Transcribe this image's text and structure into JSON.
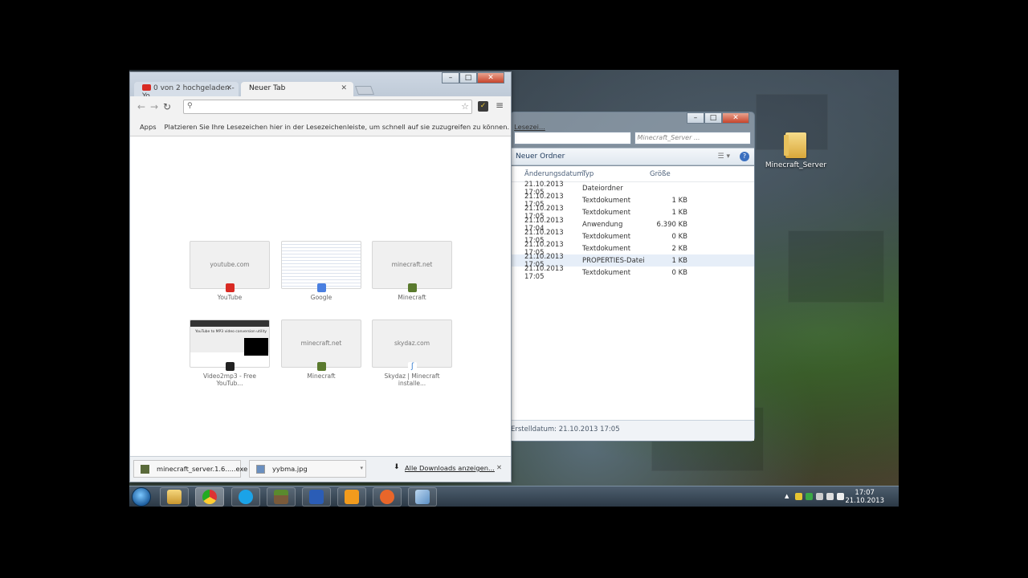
{
  "colors": {
    "chrome_tab_bg": "#f2f2f2",
    "accent": "#1e395b",
    "youtube_red": "#d82a23"
  },
  "desktop": {
    "icon_label": "Minecraft_Server",
    "icon": "folder-icon"
  },
  "explorer": {
    "search_placeholder": "Minecraft_Server ...",
    "cmd_item": "Neuer Ordner",
    "columns": [
      "Änderungsdatum",
      "Typ",
      "Größe"
    ],
    "rows": [
      {
        "date": "21.10.2013 17:05",
        "type": "Dateiordner",
        "size": ""
      },
      {
        "date": "21.10.2013 17:05",
        "type": "Textdokument",
        "size": "1 KB"
      },
      {
        "date": "21.10.2013 17:05",
        "type": "Textdokument",
        "size": "1 KB"
      },
      {
        "date": "21.10.2013 17:04",
        "type": "Anwendung",
        "size": "6.390 KB"
      },
      {
        "date": "21.10.2013 17:05",
        "type": "Textdokument",
        "size": "0 KB"
      },
      {
        "date": "21.10.2013 17:05",
        "type": "Textdokument",
        "size": "2 KB"
      },
      {
        "date": "21.10.2013 17:05",
        "type": "PROPERTIES-Datei",
        "size": "1 KB"
      },
      {
        "date": "21.10.2013 17:05",
        "type": "Textdokument",
        "size": "0 KB"
      }
    ],
    "status": "Erstelldatum: 21.10.2013 17:05"
  },
  "chrome": {
    "tabs": [
      {
        "label": "0 von 2 hochgeladen - Yo"
      },
      {
        "label": "Neuer Tab"
      }
    ],
    "omnibox_value": "",
    "bookmarks_apps": "Apps",
    "bookmarks_hint": "Platzieren Sie Ihre Lesezeichen hier in der Lesezeichenleiste, um schnell auf sie zuzugreifen zu können.",
    "bookmarks_more": "Lesezei...",
    "tiles": [
      {
        "host": "youtube.com",
        "title": "YouTube",
        "favicon": "youtube-icon"
      },
      {
        "host": "",
        "title": "Google",
        "favicon": "google-icon"
      },
      {
        "host": "minecraft.net",
        "title": "Minecraft",
        "favicon": "minecraft-icon"
      },
      {
        "host": "",
        "title": "Video2mp3 - Free YouTub...",
        "favicon": "video2mp3-icon",
        "snippet": "YouTube to MP3 video conversion utility"
      },
      {
        "host": "minecraft.net",
        "title": "Minecraft",
        "favicon": "minecraft-icon"
      },
      {
        "host": "skydaz.com",
        "title": "Skydaz | Minecraft installe...",
        "favicon": "skydaz-icon"
      }
    ],
    "downloads": [
      {
        "name": "minecraft_server.1.6.....exe"
      },
      {
        "name": "yybma.jpg"
      }
    ],
    "downloads_all": "Alle Downloads anzeigen..."
  },
  "taskbar": {
    "time": "17:07",
    "date": "21.10.2013"
  }
}
